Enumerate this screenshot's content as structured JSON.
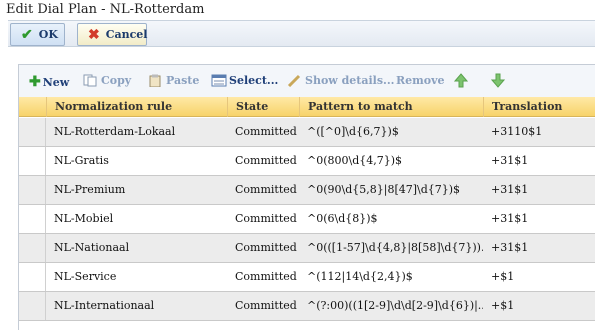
{
  "window": {
    "title": "Edit Dial Plan - NL-Rotterdam"
  },
  "commands": {
    "ok_label": "OK",
    "cancel_label": "Cancel"
  },
  "toolbar": {
    "new_label": "New",
    "copy_label": "Copy",
    "paste_label": "Paste",
    "select_label": "Select...",
    "show_details_label": "Show details...",
    "remove_label": "Remove"
  },
  "table": {
    "columns": [
      "Normalization rule",
      "State",
      "Pattern to match",
      "Translation pattern"
    ],
    "rows": [
      {
        "rule": "NL-Rotterdam-Lokaal",
        "state": "Committed",
        "pattern": "^([^0]\\d{6,7})$",
        "translation": "+3110$1"
      },
      {
        "rule": "NL-Gratis",
        "state": "Committed",
        "pattern": "^0(800\\d{4,7})$",
        "translation": "+31$1"
      },
      {
        "rule": "NL-Premium",
        "state": "Committed",
        "pattern": "^0(90\\d{5,8}|8[47]\\d{7})$",
        "translation": "+31$1"
      },
      {
        "rule": "NL-Mobiel",
        "state": "Committed",
        "pattern": "^0(6\\d{8})$",
        "translation": "+31$1"
      },
      {
        "rule": "NL-Nationaal",
        "state": "Committed",
        "pattern": "^0(([1-57]\\d{4,8}|8[58]\\d{7}))...",
        "translation": "+31$1"
      },
      {
        "rule": "NL-Service",
        "state": "Committed",
        "pattern": "^(112|14\\d{2,4})$",
        "translation": "+$1"
      },
      {
        "rule": "NL-Internationaal",
        "state": "Committed",
        "pattern": "^(?:00)((1[2-9]\\d\\d[2-9]\\d{6})|...",
        "translation": "+$1"
      }
    ]
  }
}
